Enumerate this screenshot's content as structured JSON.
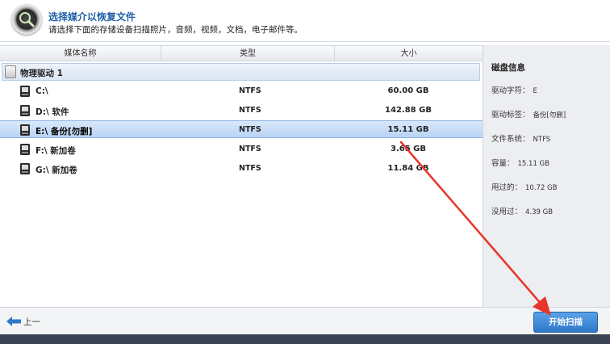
{
  "header": {
    "title": "选择媒介以恢复文件",
    "subtitle": "请选择下面的存储设备扫描照片，音频，视频，文档，电子邮件等。"
  },
  "table": {
    "columns": [
      "媒体名称",
      "类型",
      "大小"
    ],
    "group_label": "物理驱动 1",
    "rows": [
      {
        "name": "C:\\",
        "type": "NTFS",
        "size": "60.00 GB"
      },
      {
        "name": "D:\\ 软件",
        "type": "NTFS",
        "size": "142.88 GB"
      },
      {
        "name": "E:\\ 备份[勿删]",
        "type": "NTFS",
        "size": "15.11 GB"
      },
      {
        "name": "F:\\ 新加卷",
        "type": "NTFS",
        "size": "3.65 GB"
      },
      {
        "name": "G:\\ 新加卷",
        "type": "NTFS",
        "size": "11.84 GB"
      }
    ],
    "selected_row": "E:\\ 备份[勿删]"
  },
  "info": {
    "title": "磁盘信息",
    "lines": [
      {
        "label": "驱动字符：",
        "value": "E"
      },
      {
        "label": "驱动标签：",
        "value": "备份[勿删]"
      },
      {
        "label": "文件系统：",
        "value": "NTFS"
      },
      {
        "label": "容量：",
        "value": "15.11 GB"
      },
      {
        "label": "用过的：",
        "value": "10.72 GB"
      },
      {
        "label": "没用过：",
        "value": "4.39 GB"
      }
    ]
  },
  "footer": {
    "back_label": "上一",
    "start_label": "开始扫描"
  },
  "colors": {
    "accent": "#2f78c8",
    "title_blue": "#1f5fa8",
    "selection": "#b9d4f5",
    "annotation_arrow": "#e8352b"
  },
  "icons": {
    "logo": "magnifier-disc-icon",
    "group": "hard-disk-icon",
    "drive": "drive-icon",
    "back": "arrow-left-icon"
  }
}
